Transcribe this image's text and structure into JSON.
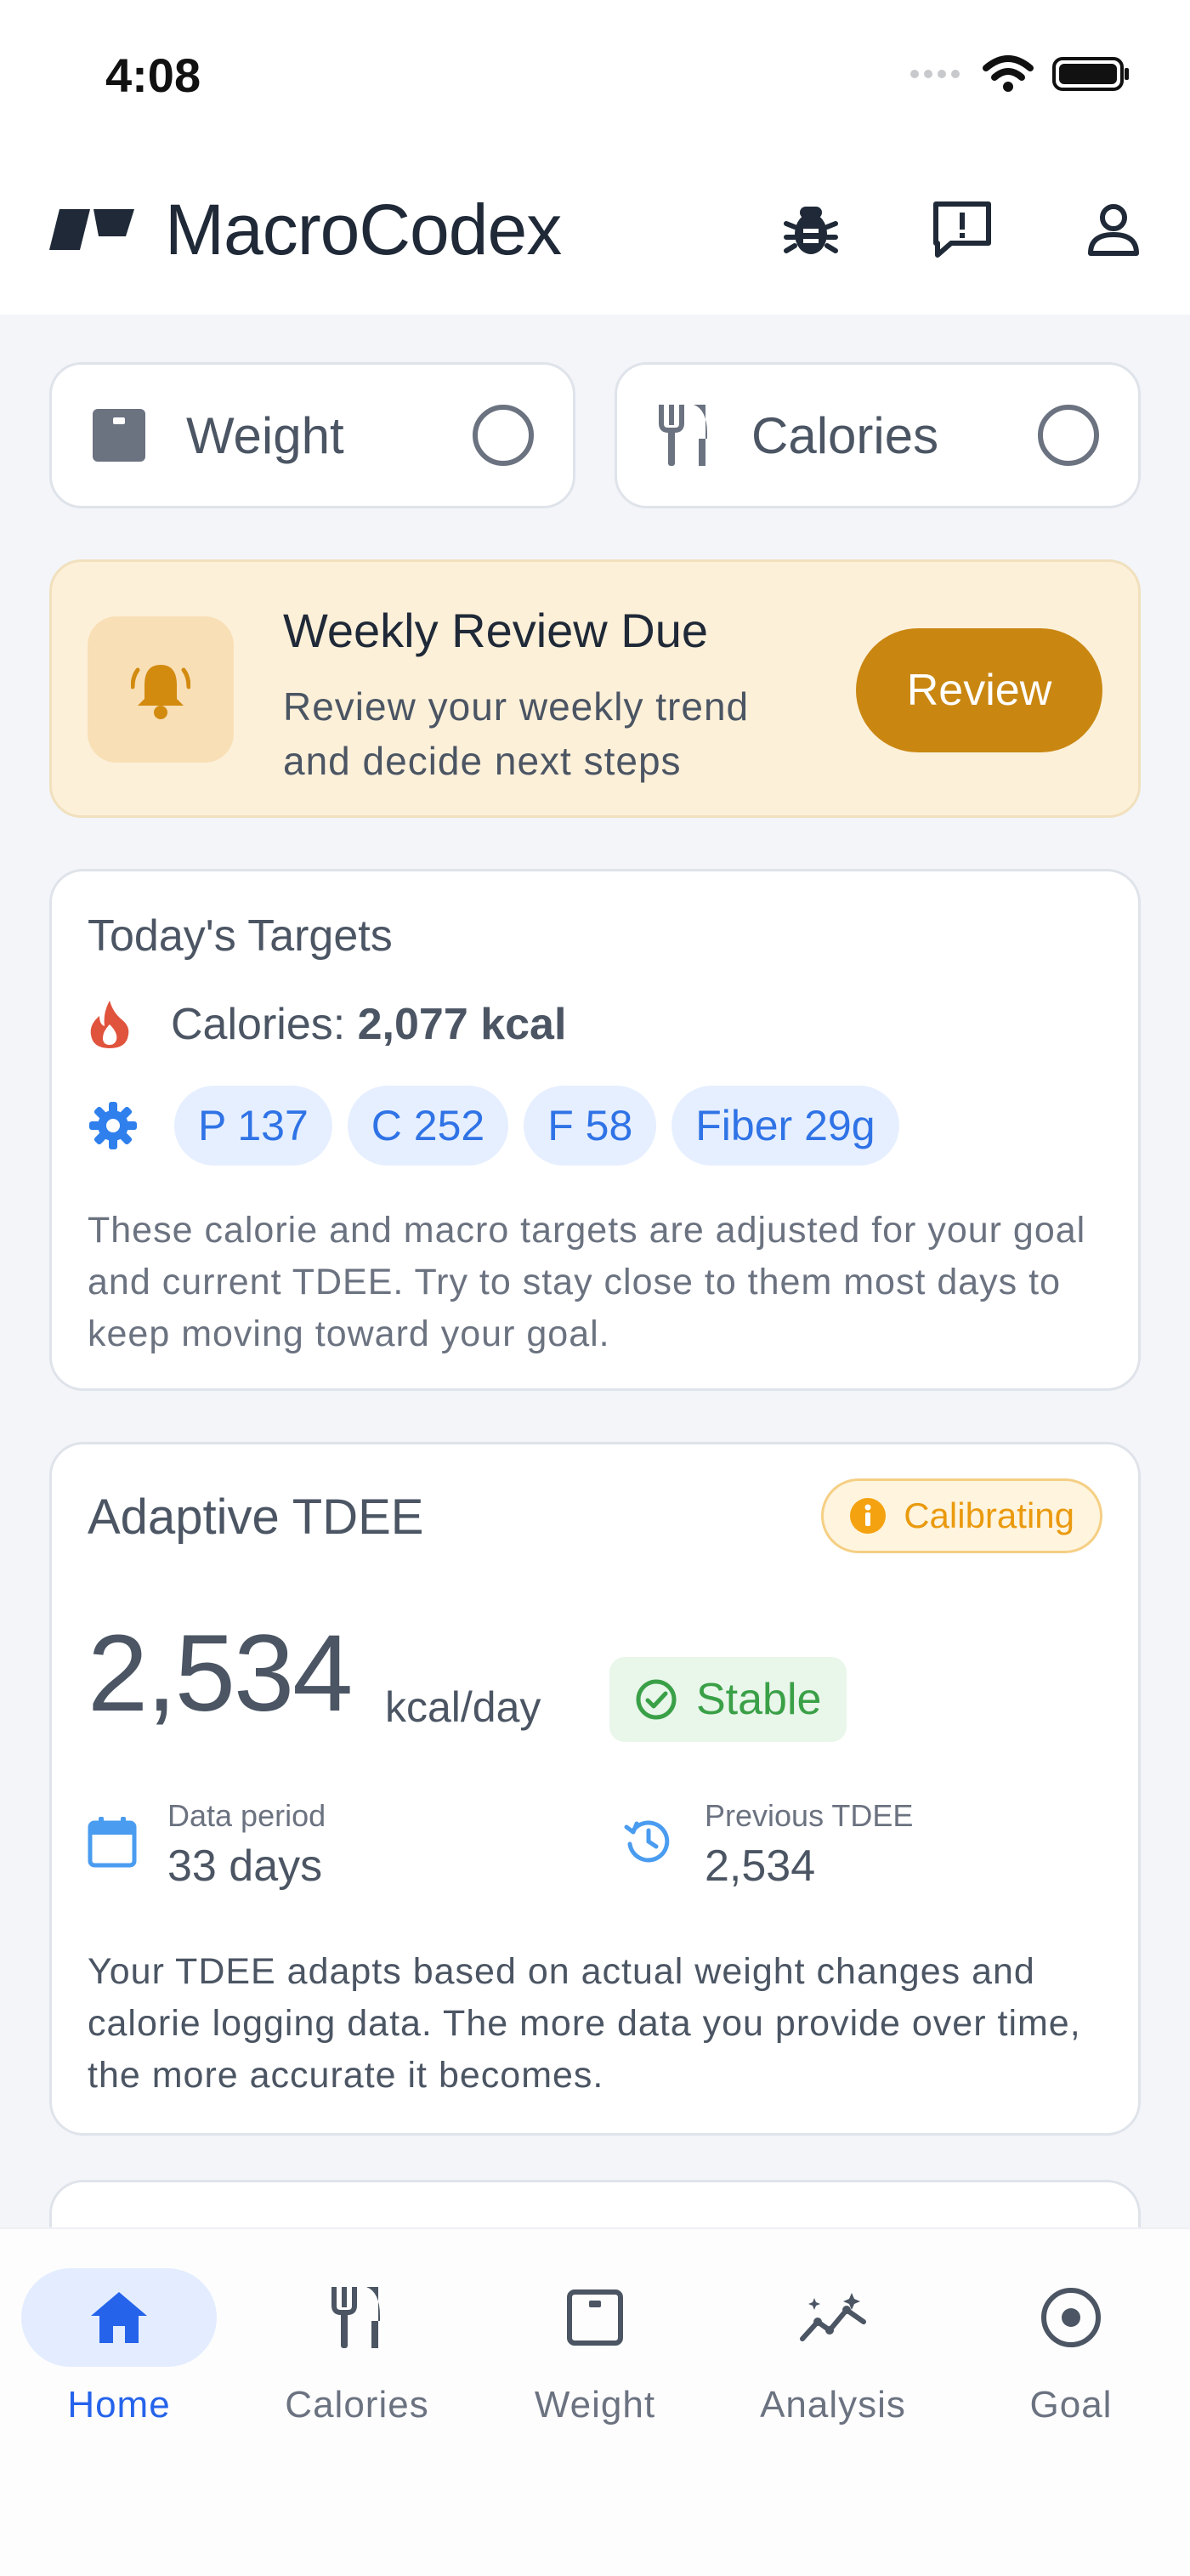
{
  "status_bar": {
    "time": "4:08"
  },
  "app": {
    "title": "MacroCodex"
  },
  "quick_actions": [
    {
      "label": "Weight",
      "icon": "scale-icon"
    },
    {
      "label": "Calories",
      "icon": "utensils-icon"
    }
  ],
  "alert": {
    "title": "Weekly Review Due",
    "text": "Review your weekly trend and decide next steps",
    "button_label": "Review"
  },
  "targets": {
    "title": "Today's Targets",
    "calories_label": "Calories: ",
    "calories_value": "2,077 kcal",
    "chips": [
      "P 137",
      "C 252",
      "F 58",
      "Fiber 29g"
    ],
    "description": "These calorie and macro targets are adjusted for your goal and current TDEE. Try to stay close to them most days to keep moving toward your goal."
  },
  "tdee": {
    "title": "Adaptive TDEE",
    "badge": "Calibrating",
    "value": "2,534",
    "unit": "kcal/day",
    "status": "Stable",
    "data_period_label": "Data period",
    "data_period_value": "33 days",
    "previous_label": "Previous TDEE",
    "previous_value": "2,534",
    "description": "Your TDEE adapts based on actual weight changes and calorie logging data. The more data you provide over time, the more accurate it becomes."
  },
  "nav": [
    {
      "label": "Home",
      "active": true
    },
    {
      "label": "Calories",
      "active": false
    },
    {
      "label": "Weight",
      "active": false
    },
    {
      "label": "Analysis",
      "active": false
    },
    {
      "label": "Goal",
      "active": false
    }
  ],
  "colors": {
    "accent": "#2563eb",
    "review": "#c98712",
    "calibrating": "#ea9a0e",
    "stable": "#3aa047",
    "flame": "#e0533d"
  }
}
